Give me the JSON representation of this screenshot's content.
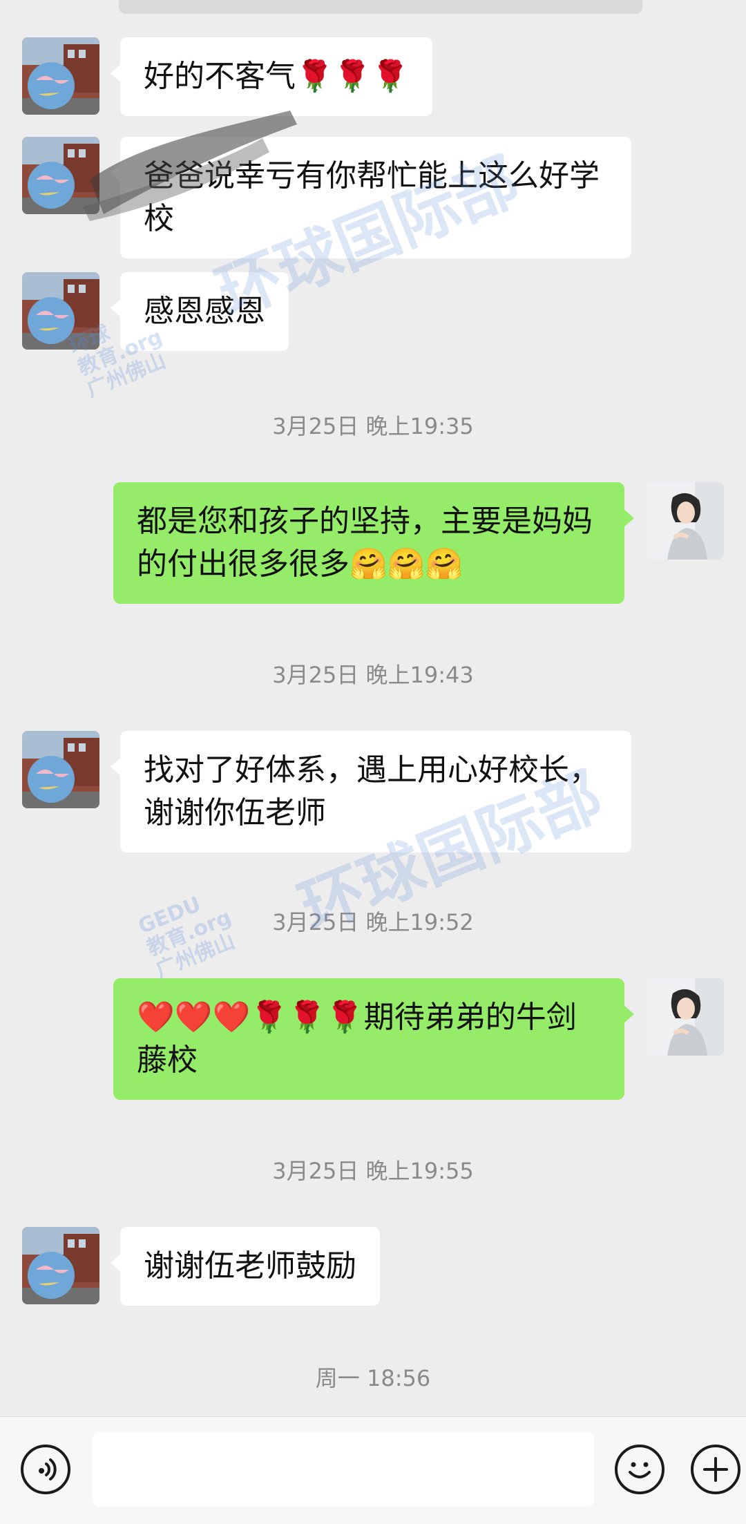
{
  "app": "WeChat chat",
  "messages": [
    {
      "side": "in",
      "text": "好的不客气🌹🌹🌹"
    },
    {
      "side": "in",
      "text": "爸爸说幸亏有你帮忙能上这么好学校"
    },
    {
      "side": "in",
      "text": "感恩感恩"
    },
    {
      "side": "out",
      "text": "都是您和孩子的坚持，主要是妈妈的付出很多很多🤗🤗🤗"
    },
    {
      "side": "in",
      "text": "找对了好体系，遇上用心好校长，谢谢你伍老师"
    },
    {
      "side": "out",
      "text": "❤️❤️❤️🌹🌹🌹期待弟弟的牛剑藤校"
    },
    {
      "side": "in",
      "text": "谢谢伍老师鼓励"
    }
  ],
  "timestamps": [
    "3月25日 晚上19:35",
    "3月25日 晚上19:43",
    "3月25日 晚上19:52",
    "3月25日 晚上19:55",
    "周一 18:56"
  ],
  "watermark": {
    "main": "环球国际部",
    "logo_cn": "环球",
    "logo_en": "GEDU",
    "logo_sub": "教育.org",
    "city": "广州佛山"
  },
  "input": {
    "placeholder": ""
  },
  "icons": {
    "voice": "voice-icon",
    "emoji": "emoji-icon",
    "plus": "plus-icon"
  },
  "colors": {
    "background": "#ededed",
    "bubble_in": "#ffffff",
    "bubble_out": "#95ec69",
    "timestamp": "#8a8a8a"
  }
}
